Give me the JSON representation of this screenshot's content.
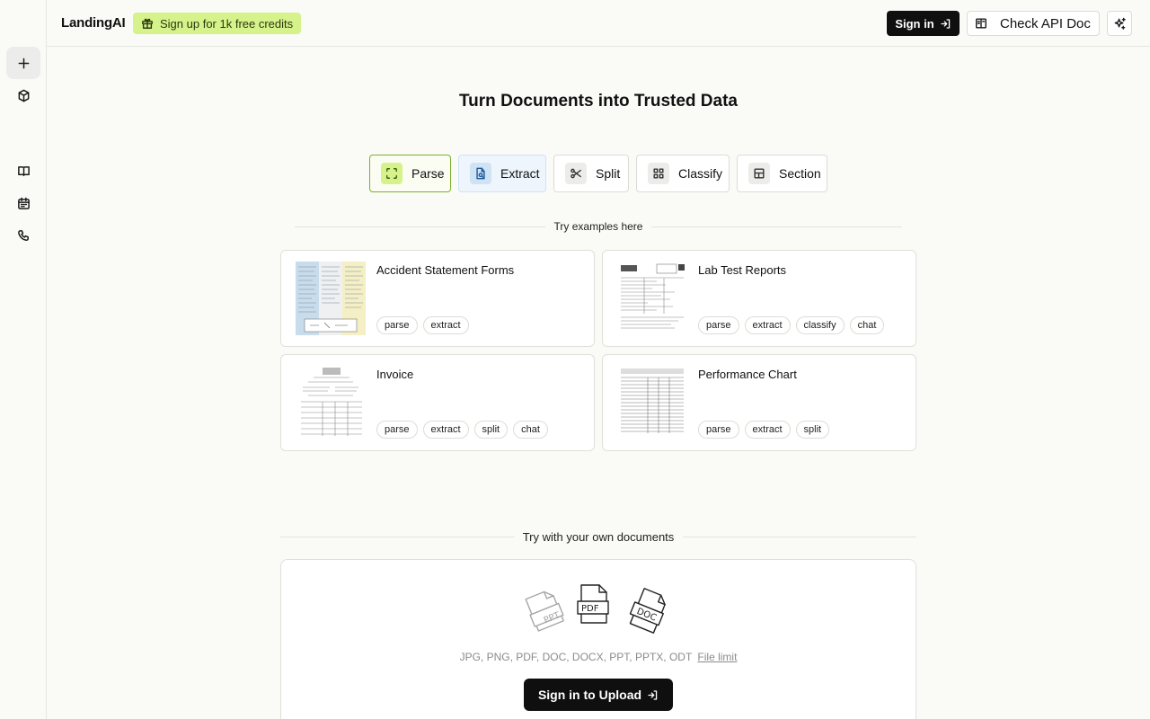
{
  "header": {
    "brand": "LandingAI",
    "promo": "Sign up for 1k free credits",
    "signin": "Sign in",
    "api_doc": "Check API Doc"
  },
  "sidebar": {
    "items": [
      {
        "icon": "plus-icon",
        "active": true
      },
      {
        "icon": "cube-icon"
      },
      {
        "icon": "book-icon"
      },
      {
        "icon": "calendar-icon"
      },
      {
        "icon": "phone-icon"
      }
    ]
  },
  "main": {
    "title": "Turn Documents into Trusted Data",
    "tabs": [
      {
        "label": "Parse",
        "icon": "scan-icon",
        "selected": true
      },
      {
        "label": "Extract",
        "icon": "file-search-icon"
      },
      {
        "label": "Split",
        "icon": "scissors-icon"
      },
      {
        "label": "Classify",
        "icon": "grid-icon"
      },
      {
        "label": "Section",
        "icon": "layout-icon"
      }
    ],
    "examples_label": "Try examples here",
    "examples": [
      {
        "title": "Accident Statement Forms",
        "tags": [
          "parse",
          "extract"
        ]
      },
      {
        "title": "Lab Test Reports",
        "tags": [
          "parse",
          "extract",
          "classify",
          "chat"
        ]
      },
      {
        "title": "Invoice",
        "tags": [
          "parse",
          "extract",
          "split",
          "chat"
        ]
      },
      {
        "title": "Performance Chart",
        "tags": [
          "parse",
          "extract",
          "split"
        ]
      }
    ],
    "own_docs_label": "Try with your own documents",
    "upload": {
      "filetypes": "JPG, PNG, PDF, DOC, DOCX, PPT, PPTX, ODT",
      "file_limit": "File limit",
      "button": "Sign in to Upload",
      "doc_badges": [
        "PPT",
        "PDF",
        "DOC"
      ]
    }
  },
  "colors": {
    "accent_green": "#d6f28a",
    "parse_border": "#7fb02c",
    "extract_bg": "#eef5fc",
    "button_dark": "#0f0f0f"
  }
}
